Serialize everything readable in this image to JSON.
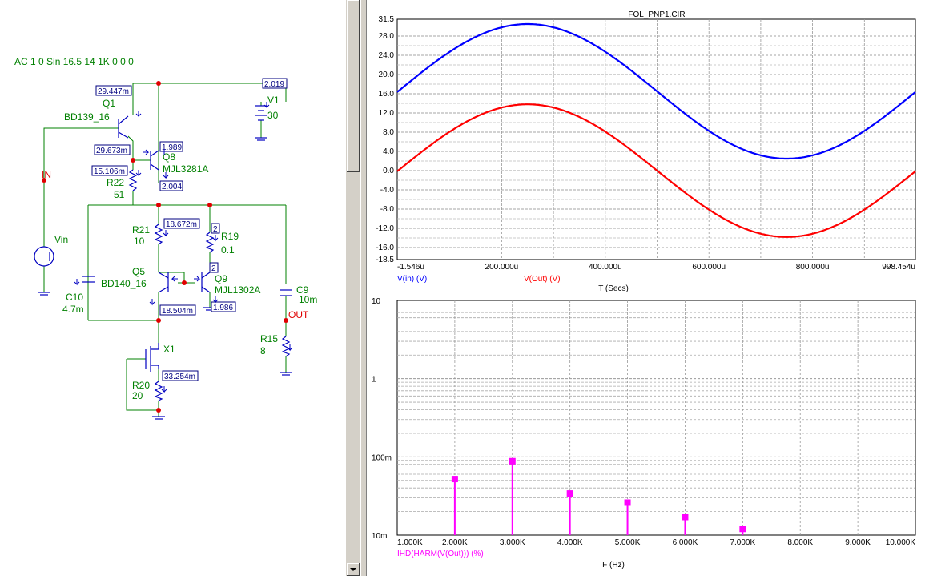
{
  "schematic": {
    "source_line": "AC 1 0 Sin 16.5 14 1K 0 0 0",
    "labels": {
      "q1_name": "Q1",
      "q1_model": "BD139_16",
      "q8_name": "Q8",
      "q8_model": "MJL3281A",
      "q5_name": "Q5",
      "q5_model": "BD140_16",
      "q9_name": "Q9",
      "q9_model": "MJL1302A",
      "r22_name": "R22",
      "r22_val": "51",
      "r21_name": "R21",
      "r21_val": "10",
      "r19_name": "R19",
      "r19_val": "0.1",
      "r20_name": "R20",
      "r20_val": "20",
      "r15_name": "R15",
      "r15_val": "8",
      "c10_name": "C10",
      "c10_val": "4.7m",
      "c9_name": "C9",
      "c9_val": "10m",
      "v1_name": "V1",
      "v1_val": "30",
      "vin_name": "Vin",
      "x1_name": "X1",
      "in_node": "IN",
      "out_node": "OUT"
    },
    "readouts": {
      "q1_collector": "29.447m",
      "v1_current": "2.019",
      "q1_emitter": "29.673m",
      "q8_collector": "1.989",
      "r22_current": "15.106m",
      "q8_emitter": "2.004",
      "r21_current": "18.672m",
      "r19_current": "2",
      "q9_base": "2",
      "q5_emitter": "18.504m",
      "q9_emitter": "1.986",
      "x1_current": "33.254m"
    }
  },
  "plot_top": {
    "title": "FOL_PNP1.CIR",
    "xlabel": "T (Secs)",
    "legend": [
      {
        "name": "V(in) (V)",
        "color": "#0000ff"
      },
      {
        "name": "V(Out) (V)",
        "color": "#ff0000"
      }
    ],
    "yticks": [
      "31.5",
      "28.0",
      "24.0",
      "20.0",
      "16.0",
      "12.0",
      "8.0",
      "4.0",
      "0.0",
      "-4.0",
      "-8.0",
      "-12.0",
      "-16.0",
      "-18.5"
    ],
    "xticks": [
      "-1.546u",
      "200.000u",
      "400.000u",
      "600.000u",
      "800.000u",
      "998.454u"
    ]
  },
  "plot_bottom": {
    "xlabel": "F (Hz)",
    "legend": "IHD(HARM(V(Out))) (%)",
    "yticks": [
      "10",
      "1",
      "100m",
      "10m"
    ],
    "xticks": [
      "1.000K",
      "2.000K",
      "3.000K",
      "4.000K",
      "5.000K",
      "6.000K",
      "7.000K",
      "8.000K",
      "9.000K",
      "10.000K"
    ]
  },
  "chart_data": [
    {
      "type": "line",
      "title": "FOL_PNP1.CIR",
      "xlabel": "T (Secs)",
      "ylabel": "",
      "xlim": [
        -1.546e-06,
        0.000998454
      ],
      "ylim": [
        -18.5,
        31.5
      ],
      "grid": true,
      "legend_position": "bottom-left",
      "series": [
        {
          "name": "V(in) (V)",
          "color": "#0000ff",
          "offset": 16.5,
          "amplitude": 14,
          "frequency_hz": 1000,
          "x": [
            0,
            0.00025,
            0.0005,
            0.00075,
            0.001
          ],
          "y": [
            16.5,
            30.5,
            16.5,
            2.5,
            16.5
          ]
        },
        {
          "name": "V(Out) (V)",
          "color": "#ff0000",
          "offset": 0,
          "amplitude": 13.8,
          "frequency_hz": 1000,
          "x": [
            0,
            0.00025,
            0.0005,
            0.00075,
            0.001
          ],
          "y": [
            0,
            13.8,
            0,
            -13.8,
            0
          ]
        }
      ]
    },
    {
      "type": "bar",
      "xlabel": "F (Hz)",
      "ylabel": "",
      "ylim": [
        0.01,
        10
      ],
      "y_scale": "log",
      "xlim": [
        1000,
        10000
      ],
      "grid": true,
      "color": "#ff00ff",
      "series": [
        {
          "name": "IHD(HARM(V(Out))) (%)",
          "x": [
            2000,
            3000,
            4000,
            5000,
            6000,
            7000
          ],
          "values": [
            0.052,
            0.088,
            0.034,
            0.026,
            0.017,
            0.012
          ]
        }
      ]
    }
  ]
}
